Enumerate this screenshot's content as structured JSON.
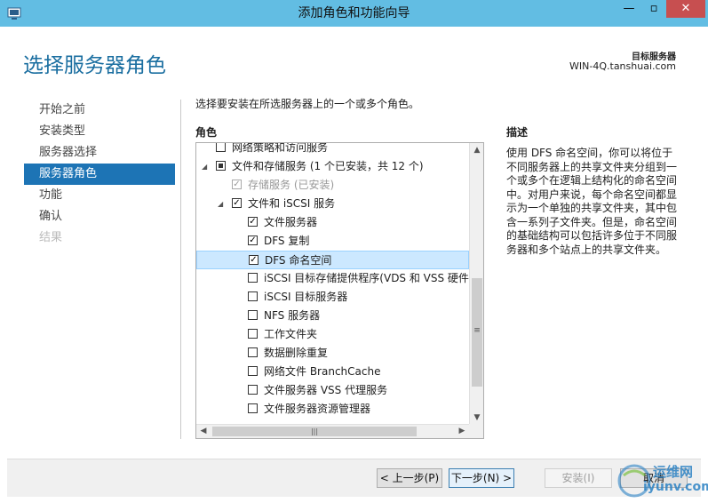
{
  "window": {
    "title": "添加角色和功能向导",
    "controls": {
      "minimize": "—",
      "maximize": "▫",
      "close": "✕"
    }
  },
  "page": {
    "heading": "选择服务器角色",
    "destination_label": "目标服务器",
    "destination_server": "WIN-4Q.tanshuai.com"
  },
  "nav": {
    "items": [
      {
        "label": "开始之前",
        "state": "normal"
      },
      {
        "label": "安装类型",
        "state": "normal"
      },
      {
        "label": "服务器选择",
        "state": "normal"
      },
      {
        "label": "服务器角色",
        "state": "active"
      },
      {
        "label": "功能",
        "state": "normal"
      },
      {
        "label": "确认",
        "state": "normal"
      },
      {
        "label": "结果",
        "state": "disabled"
      }
    ]
  },
  "main": {
    "instruction": "选择要安装在所选服务器上的一个或多个角色。",
    "roles_label": "角色",
    "tree": [
      {
        "label": "网络策略和访问服务",
        "check": "none",
        "arrow": "",
        "indent": 0,
        "clipped": true
      },
      {
        "label": "文件和存储服务 (1 个已安装，共 12 个)",
        "check": "partial",
        "arrow": "◢",
        "indent": 0
      },
      {
        "label": "存储服务 (已安装)",
        "check": "checked",
        "arrow": "",
        "indent": 1,
        "disabled": true
      },
      {
        "label": "文件和 iSCSI 服务",
        "check": "checked",
        "arrow": "◢",
        "indent": 1
      },
      {
        "label": "文件服务器",
        "check": "checked",
        "arrow": "",
        "indent": 2
      },
      {
        "label": "DFS 复制",
        "check": "checked",
        "arrow": "",
        "indent": 2
      },
      {
        "label": "DFS 命名空间",
        "check": "checked",
        "arrow": "",
        "indent": 2,
        "selected": true
      },
      {
        "label": "iSCSI 目标存储提供程序(VDS 和 VSS 硬件提供程序)",
        "check": "none",
        "arrow": "",
        "indent": 2
      },
      {
        "label": "iSCSI 目标服务器",
        "check": "none",
        "arrow": "",
        "indent": 2
      },
      {
        "label": "NFS 服务器",
        "check": "none",
        "arrow": "",
        "indent": 2
      },
      {
        "label": "工作文件夹",
        "check": "none",
        "arrow": "",
        "indent": 2
      },
      {
        "label": "数据删除重复",
        "check": "none",
        "arrow": "",
        "indent": 2
      },
      {
        "label": "网络文件 BranchCache",
        "check": "none",
        "arrow": "",
        "indent": 2
      },
      {
        "label": "文件服务器 VSS 代理服务",
        "check": "none",
        "arrow": "",
        "indent": 2
      },
      {
        "label": "文件服务器资源管理器",
        "check": "none",
        "arrow": "",
        "indent": 2
      }
    ],
    "scrollbar": {
      "up": "▲",
      "down": "▼",
      "grip": "≡",
      "left": "◀",
      "right": "▶",
      "hgrip": "|||"
    }
  },
  "description": {
    "label": "描述",
    "text": "使用 DFS 命名空间，你可以将位于不同服务器上的共享文件夹分组到一个或多个在逻辑上结构化的命名空间中。对用户来说，每个命名空间都显示为一个单独的共享文件夹，其中包含一系列子文件夹。但是，命名空间的基础结构可以包括许多位于不同服务器和多个站点上的共享文件夹。"
  },
  "footer": {
    "prev": "< 上一步(P)",
    "next": "下一步(N) >",
    "install": "安装(I)",
    "cancel": "取消"
  },
  "watermark": {
    "line1": "运维网",
    "line2": "iyunv.com"
  },
  "colors": {
    "titlebar": "#62bde3",
    "accent": "#1d74b5",
    "heading": "#1a6ea0",
    "selection": "#cce8ff",
    "close": "#c74f50"
  }
}
